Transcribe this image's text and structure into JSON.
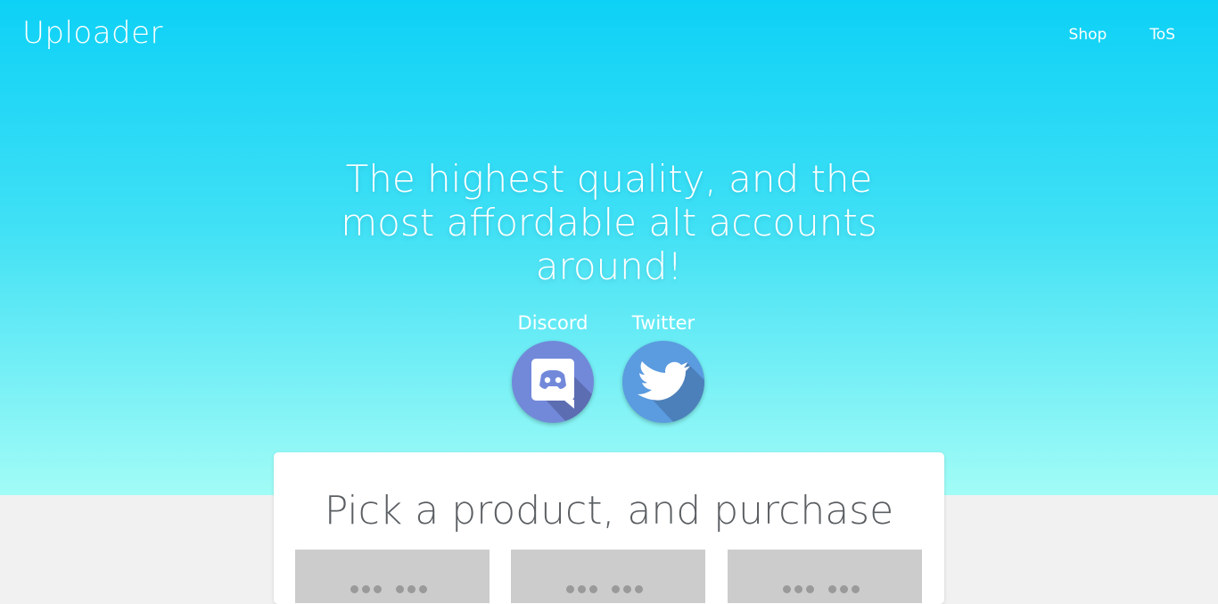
{
  "brand": "Uploader",
  "nav": [
    {
      "label": "Shop"
    },
    {
      "label": "ToS"
    }
  ],
  "hero": {
    "headline": "The highest quality, and the most affordable alt accounts around!"
  },
  "social": [
    {
      "label": "Discord",
      "icon": "discord-icon",
      "color": "#7289da"
    },
    {
      "label": "Twitter",
      "icon": "twitter-icon",
      "color": "#5b9be0"
    }
  ],
  "card": {
    "title": "Pick a product, and purchase"
  },
  "colors": {
    "hero_top": "#0dd1f6",
    "hero_bottom": "#a2fcf6",
    "page_bg": "#f1f1f1",
    "product_placeholder": "#cccccc"
  }
}
